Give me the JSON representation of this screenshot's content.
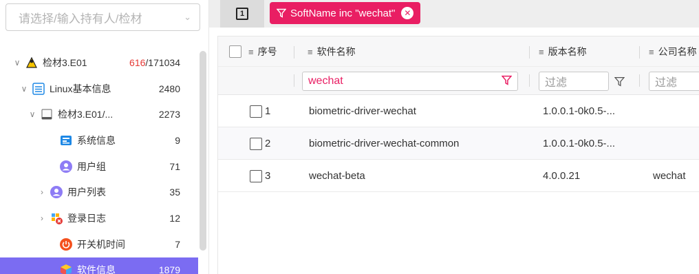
{
  "owner_select": {
    "placeholder": "请选择/输入持有人/检材"
  },
  "tree": [
    {
      "label": "检材3.E01",
      "count_red": "616",
      "count_rest": "/171034",
      "icon": "user-triangle-icon",
      "arrow": "down"
    },
    {
      "label": "Linux基本信息",
      "count": "2480",
      "icon": "list-icon",
      "arrow": "down"
    },
    {
      "label": "检材3.E01/...",
      "count": "2273",
      "icon": "drive-icon",
      "arrow": "down"
    },
    {
      "label": "系统信息",
      "count": "9",
      "icon": "sysinfo-icon",
      "arrow": ""
    },
    {
      "label": "用户组",
      "count": "71",
      "icon": "user-icon",
      "arrow": ""
    },
    {
      "label": "用户列表",
      "count": "35",
      "icon": "user-icon",
      "arrow": "right"
    },
    {
      "label": "登录日志",
      "count": "12",
      "icon": "login-log-icon",
      "arrow": "right"
    },
    {
      "label": "开关机时间",
      "count": "7",
      "icon": "power-icon",
      "arrow": ""
    },
    {
      "label": "软件信息",
      "count": "1879",
      "icon": "software-cube-icon",
      "arrow": ""
    }
  ],
  "toolbar": {
    "square_label": "1",
    "filter_tag": "SoftName inc \"wechat\""
  },
  "table": {
    "headers": {
      "index": "序号",
      "name": "软件名称",
      "version": "版本名称",
      "company": "公司名称"
    },
    "filters": {
      "name_value": "wechat",
      "version_placeholder": "过滤",
      "company_placeholder": "过滤"
    },
    "rows": [
      {
        "index": "1",
        "name": "biometric-driver-wechat",
        "version": "1.0.0.1-0k0.5-...",
        "company": ""
      },
      {
        "index": "2",
        "name": "biometric-driver-wechat-common",
        "version": "1.0.0.1-0k0.5-...",
        "company": ""
      },
      {
        "index": "3",
        "name": "wechat-beta",
        "version": "4.0.0.21",
        "company": "wechat"
      }
    ]
  },
  "colors": {
    "accent": "#e91e63",
    "selected": "#7b6cf2",
    "count_red": "#e53935"
  }
}
